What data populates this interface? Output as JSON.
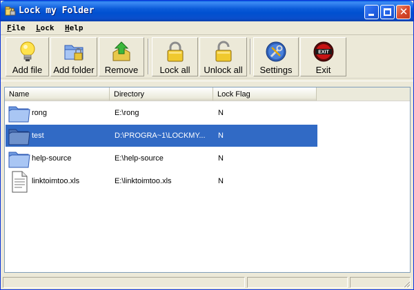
{
  "window": {
    "title": "Lock my Folder"
  },
  "menu": [
    {
      "underline": "F",
      "rest": "ile"
    },
    {
      "underline": "L",
      "rest": "ock"
    },
    {
      "underline": "H",
      "rest": "elp"
    }
  ],
  "toolbar": {
    "add_file": "Add file",
    "add_folder": "Add folder",
    "remove": "Remove",
    "lock_all": "Lock all",
    "unlock_all": "Unlock all",
    "settings": "Settings",
    "exit": "Exit"
  },
  "icons": {
    "add_file": "lightbulb-icon",
    "add_folder": "folder-lock-icon",
    "remove": "remove-arrow-icon",
    "lock_all": "padlock-closed-icon",
    "unlock_all": "padlock-open-icon",
    "settings": "gear-settings-icon",
    "exit": "exit-icon"
  },
  "list": {
    "columns": [
      "Name",
      "Directory",
      "Lock Flag"
    ],
    "rows": [
      {
        "name": "rong",
        "directory": "E:\\rong",
        "lock_flag": "N",
        "type": "folder",
        "selected": false
      },
      {
        "name": "test",
        "directory": "D:\\PROGRA~1\\LOCKMY...",
        "lock_flag": "N",
        "type": "folder",
        "selected": true
      },
      {
        "name": "help-source",
        "directory": "E:\\help-source",
        "lock_flag": "N",
        "type": "folder",
        "selected": false
      },
      {
        "name": "linktoimtoo.xls",
        "directory": "E:\\linktoimtoo.xls",
        "lock_flag": "N",
        "type": "file",
        "selected": false
      }
    ]
  },
  "colors": {
    "selection": "#316ac5",
    "titlebar": "#0a5ad8",
    "face": "#ece9d8"
  }
}
